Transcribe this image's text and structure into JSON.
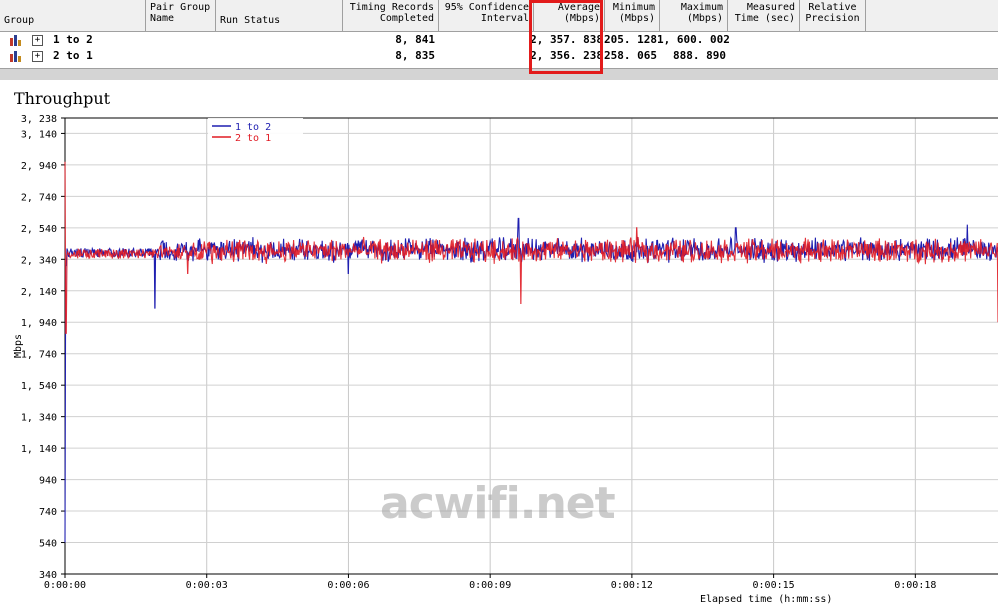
{
  "table": {
    "headers": {
      "group": "Group",
      "pair_group_name": "Pair Group\nName",
      "run_status": "Run Status",
      "timing_records": "Timing Records\nCompleted",
      "confidence": "95% Confidence\nInterval",
      "average": "Average\n(Mbps)",
      "minimum": "Minimum\n(Mbps)",
      "maximum": "Maximum\n(Mbps)",
      "measured_time": "Measured\nTime (sec)",
      "relative_precision": "Relative\nPrecision"
    },
    "rows": [
      {
        "group": "1 to 2",
        "records": "8, 841",
        "average": "2, 357. 838",
        "minimum": "205. 128",
        "maximum": "1, 600. 002"
      },
      {
        "group": "2 to 1",
        "records": "8, 835",
        "average": "2, 356. 238",
        "minimum": "258. 065",
        "maximum": "888. 890"
      }
    ],
    "highlight_color": "#e21b1b"
  },
  "chart_title": "Throughput",
  "watermark": "acwifi.net",
  "x_unit_fragment": "Elapsed time (h:mm:ss)",
  "chart_data": {
    "type": "line",
    "title": "Throughput",
    "ylabel": "Mbps",
    "xlabel": "",
    "ylim": [
      340,
      3238
    ],
    "xlim": [
      0,
      19.75
    ],
    "y_ticks": [
      340,
      540,
      740,
      940,
      1140,
      1340,
      1540,
      1740,
      1940,
      2140,
      2340,
      2540,
      2740,
      2940,
      3140,
      3238
    ],
    "y_tick_labels": [
      "340",
      "540",
      "740",
      "940",
      "1, 140",
      "1, 340",
      "1, 540",
      "1, 740",
      "1, 940",
      "2, 140",
      "2, 340",
      "2, 540",
      "2, 740",
      "2, 940",
      "3, 140",
      "3, 238"
    ],
    "x_ticks": [
      0,
      3,
      6,
      9,
      12,
      15,
      18
    ],
    "x_tick_labels": [
      "0:00:00",
      "0:00:03",
      "0:00:06",
      "0:00:09",
      "0:00:12",
      "0:00:15",
      "0:00:18"
    ],
    "grid": true,
    "legend_position": "top-left",
    "series": [
      {
        "name": "1 to 2",
        "color": "#1f1fb0",
        "mean": 2400,
        "spread": 55,
        "spikes": [
          [
            0.0,
            540
          ],
          [
            0.02,
            2300
          ],
          [
            1.9,
            2030
          ],
          [
            6.0,
            2250
          ],
          [
            9.6,
            2600
          ],
          [
            14.2,
            2540
          ],
          [
            19.1,
            2560
          ]
        ]
      },
      {
        "name": "2 to 1",
        "color": "#e01b24",
        "mean": 2395,
        "spread": 55,
        "spikes": [
          [
            0.0,
            2960
          ],
          [
            0.02,
            1870
          ],
          [
            2.6,
            2250
          ],
          [
            9.65,
            2060
          ],
          [
            19.75,
            1940
          ],
          [
            12.1,
            2540
          ]
        ]
      }
    ]
  }
}
